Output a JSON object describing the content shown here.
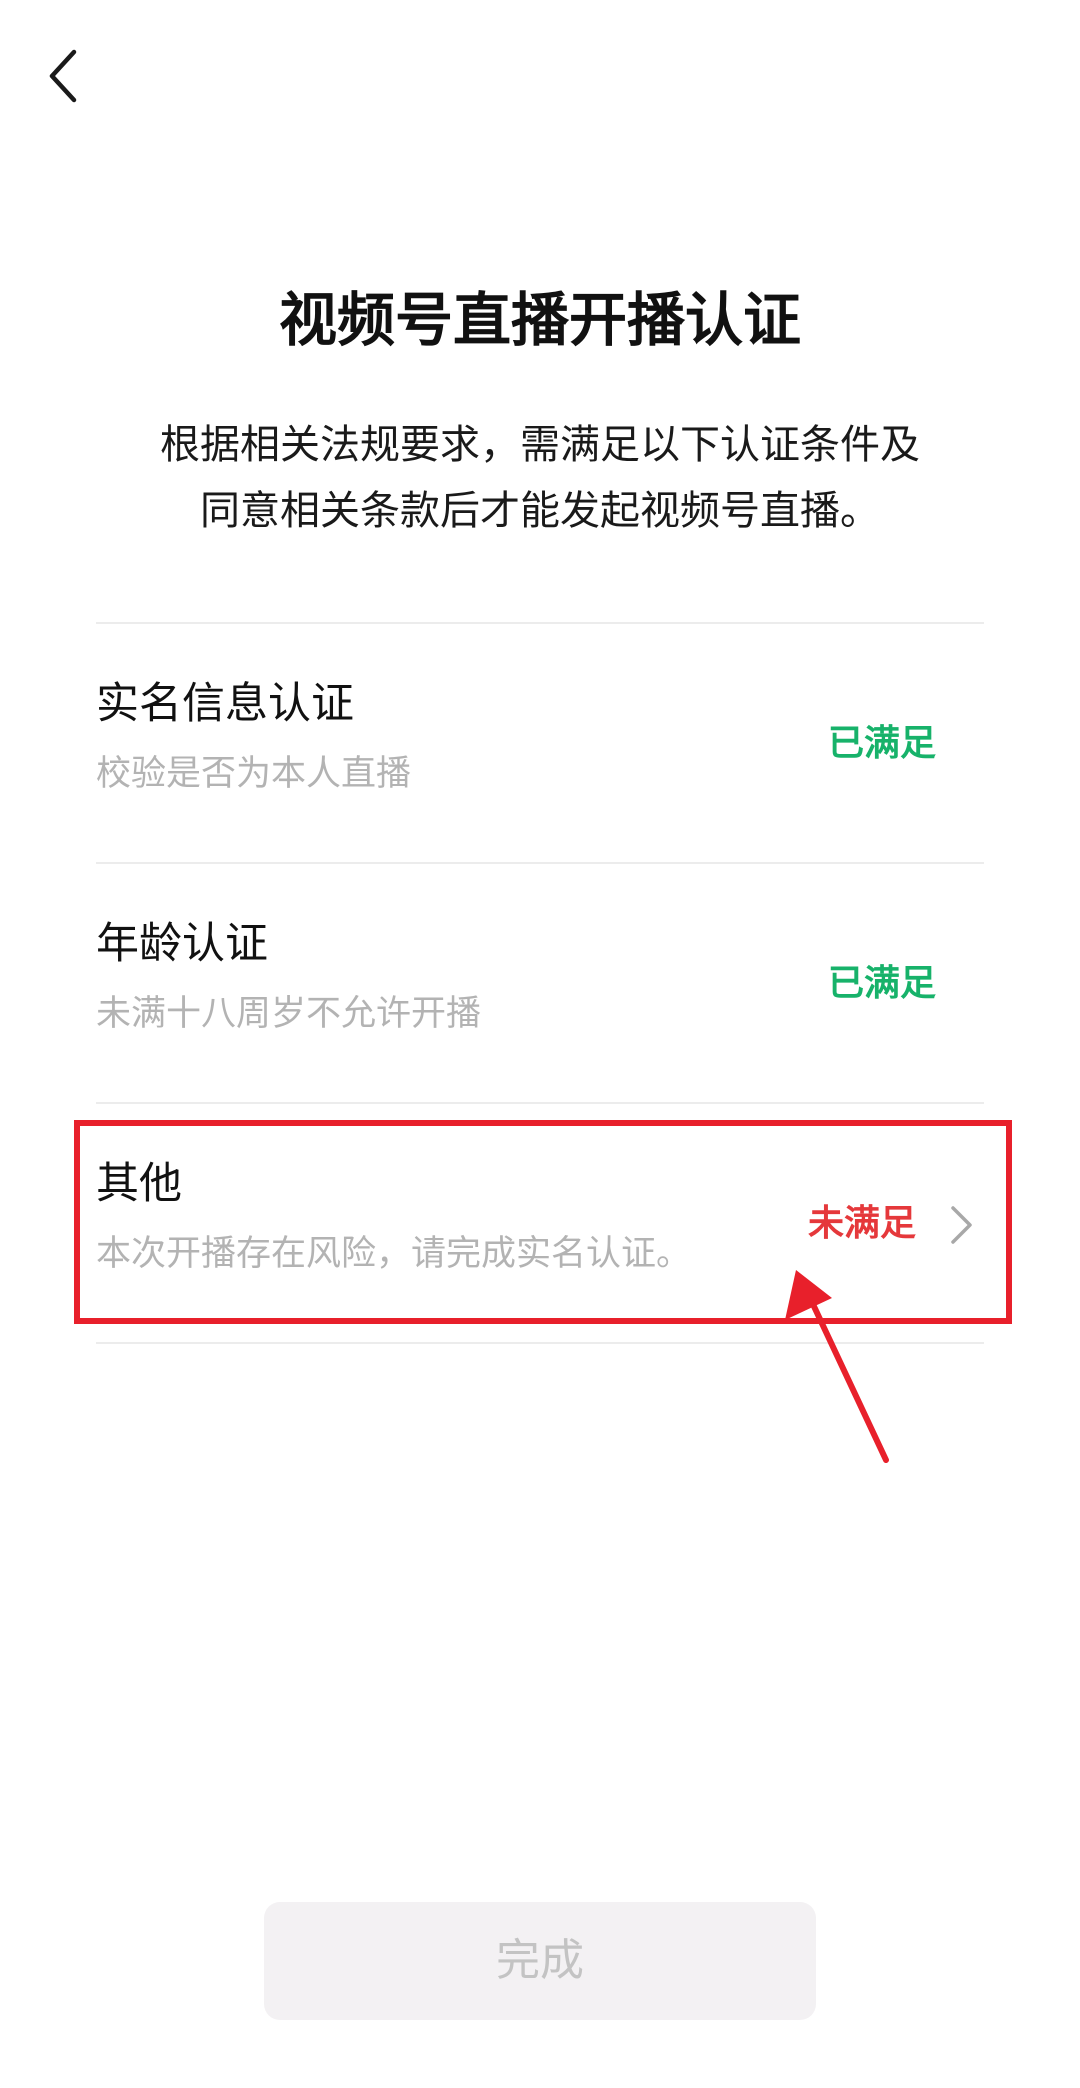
{
  "header": {
    "back_icon": "chevron-left-icon"
  },
  "page": {
    "title": "视频号直播开播认证",
    "description_line1": "根据相关法规要求，需满足以下认证条件及",
    "description_line2": "同意相关条款后才能发起视频号直播。"
  },
  "requirements": [
    {
      "title": "实名信息认证",
      "description": "校验是否为本人直播",
      "status": "已满足",
      "status_color": "#17b26a"
    },
    {
      "title": "年龄认证",
      "description": "未满十八周岁不允许开播",
      "status": "已满足",
      "status_color": "#17b26a"
    },
    {
      "title": "其他",
      "description": "本次开播存在风险，请完成实名认证。",
      "status": "未满足",
      "status_color": "#e5383b",
      "trailing_icon": "chevron-right-icon"
    }
  ],
  "annotation": {
    "highlight_color": "#e8202b"
  },
  "footer": {
    "done_label": "完成",
    "done_enabled": false
  }
}
